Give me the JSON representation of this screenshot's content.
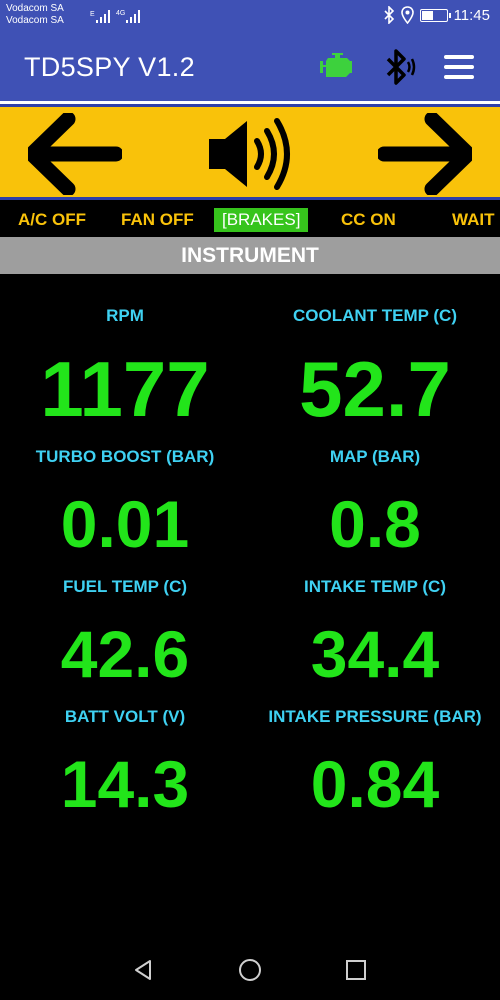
{
  "status": {
    "carrier1": "Vodacom SA",
    "carrier2": "Vodacom SA",
    "net1": "E",
    "net2": "4G",
    "time": "11:45",
    "battery_level": 0.45
  },
  "app": {
    "title": "TD5SPY V1.2",
    "icons": [
      "engine-check-icon",
      "bluetooth-icon",
      "menu-icon"
    ]
  },
  "controls": {
    "icons": [
      "arrow-left-icon",
      "speaker-icon",
      "arrow-right-icon"
    ]
  },
  "indicators": [
    {
      "label": "A/C OFF",
      "active": false
    },
    {
      "label": "FAN OFF",
      "active": false
    },
    {
      "label": "[BRAKES]",
      "active": true
    },
    {
      "label": "CC ON",
      "active": false
    },
    {
      "label": "WAIT",
      "active": false
    }
  ],
  "section": {
    "title": "INSTRUMENT"
  },
  "gauges": [
    {
      "label": "RPM",
      "value": "1177"
    },
    {
      "label": "COOLANT TEMP (C)",
      "value": "52.7"
    },
    {
      "label": "TURBO BOOST (BAR)",
      "value": "0.01"
    },
    {
      "label": "MAP (BAR)",
      "value": "0.8"
    },
    {
      "label": "FUEL TEMP (C)",
      "value": "42.6"
    },
    {
      "label": "INTAKE TEMP (C)",
      "value": "34.4"
    },
    {
      "label": "BATT VOLT (V)",
      "value": "14.3"
    },
    {
      "label": "INTAKE PRESSURE (BAR)",
      "value": "0.84"
    }
  ],
  "nav": {
    "icons": [
      "back-icon",
      "home-icon",
      "recents-icon"
    ]
  },
  "colors": {
    "app_bar": "#3f51b5",
    "panel": "#f9c20a",
    "indicator_text": "#f9c20a",
    "indicator_active": "#36c41c",
    "label": "#3fd1f2",
    "value": "#22e51a",
    "header": "#9e9e9e"
  }
}
